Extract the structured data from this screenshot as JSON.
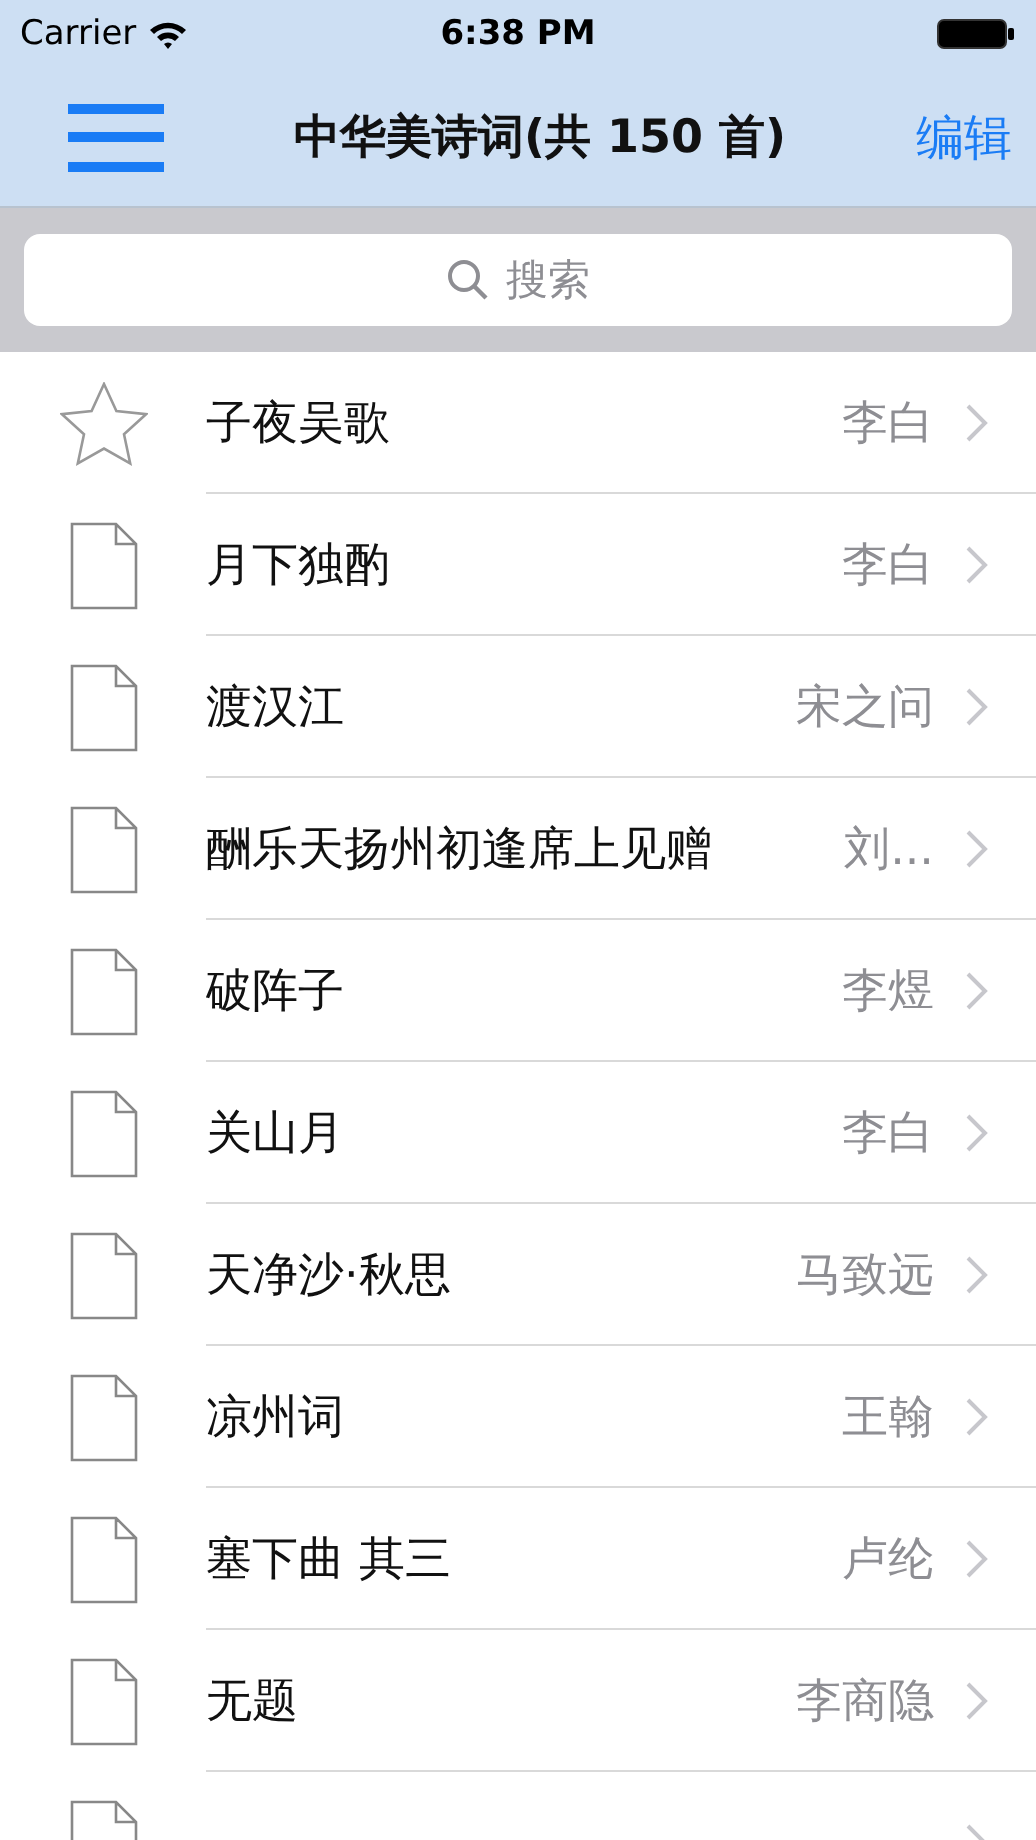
{
  "status_bar": {
    "carrier": "Carrier",
    "time": "6:38 PM"
  },
  "nav_bar": {
    "title": "中华美诗词(共 150 首)",
    "edit_button": "编辑"
  },
  "search": {
    "placeholder": "搜索"
  },
  "poems": [
    {
      "title": "子夜吴歌",
      "author": "李白",
      "starred": true
    },
    {
      "title": "月下独酌",
      "author": "李白",
      "starred": false
    },
    {
      "title": "渡汉江",
      "author": "宋之问",
      "starred": false
    },
    {
      "title": "酬乐天扬州初逢席上见赠",
      "author": "刘...",
      "starred": false
    },
    {
      "title": "破阵子",
      "author": "李煜",
      "starred": false
    },
    {
      "title": "关山月",
      "author": "李白",
      "starred": false
    },
    {
      "title": "天净沙·秋思",
      "author": "马致远",
      "starred": false
    },
    {
      "title": "凉州词",
      "author": "王翰",
      "starred": false
    },
    {
      "title": "塞下曲 其三",
      "author": "卢纶",
      "starred": false
    },
    {
      "title": "无题",
      "author": "李商隐",
      "starred": false
    },
    {
      "starred": false
    }
  ]
}
